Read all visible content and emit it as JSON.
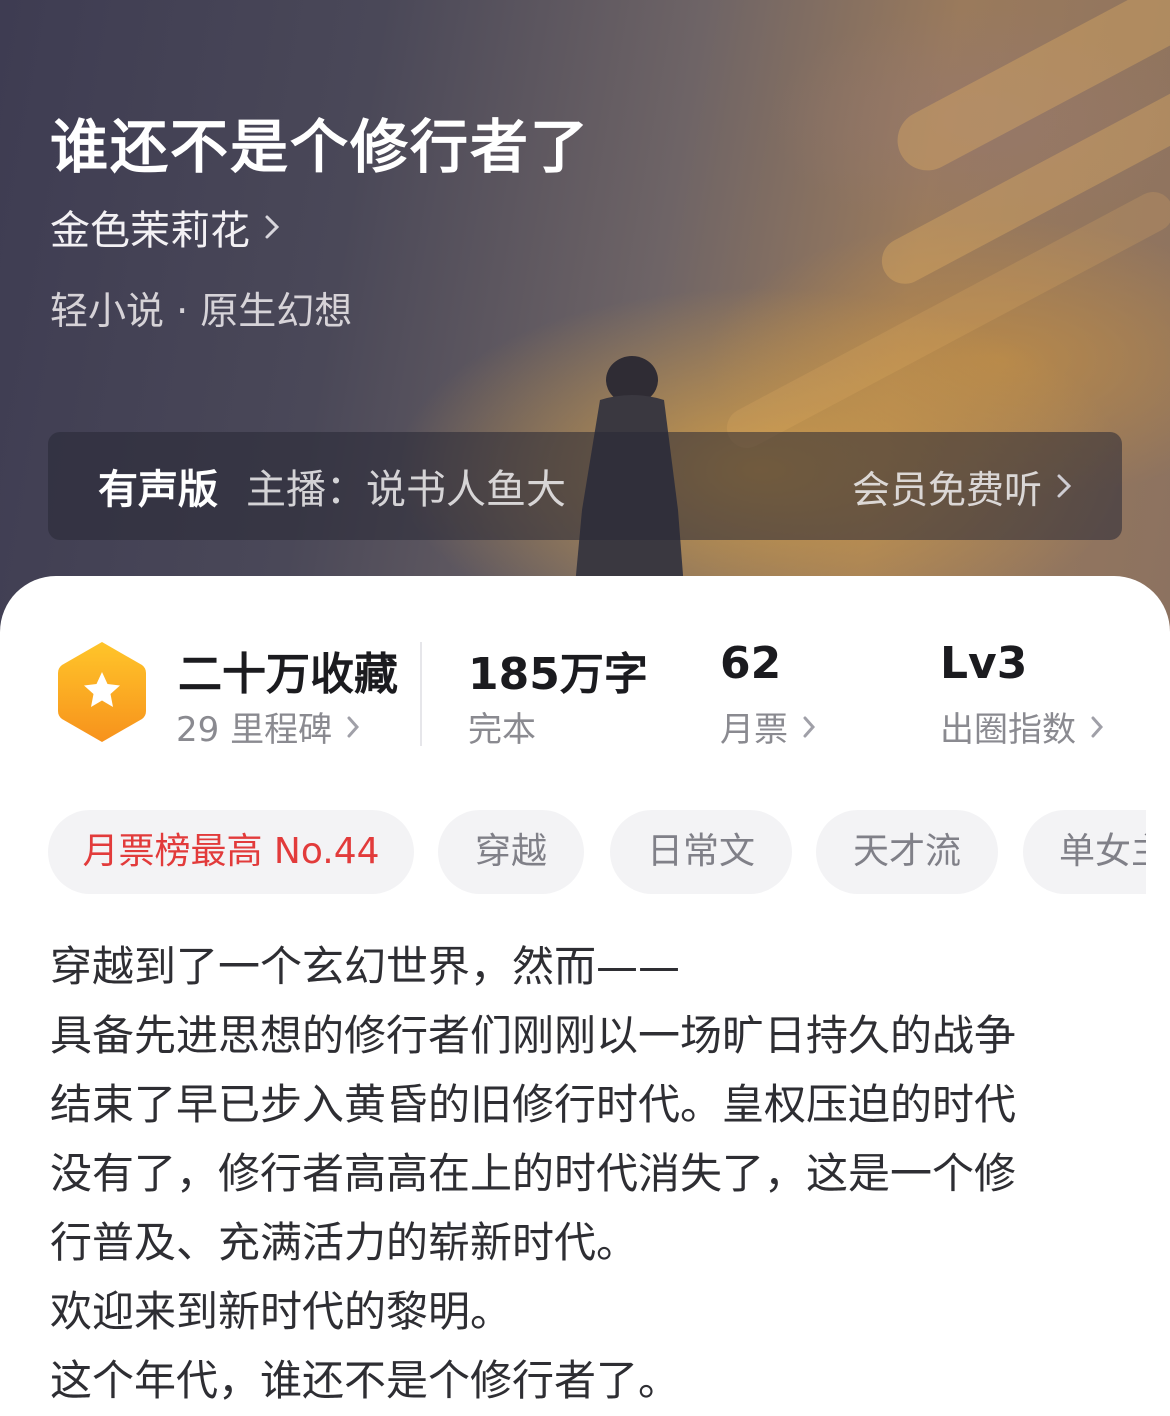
{
  "book": {
    "title": "谁还不是个修行者了",
    "author": "金色茉莉花",
    "genre": "轻小说 · 原生幻想"
  },
  "audio": {
    "label": "有声版",
    "host": "主播：说书人鱼大",
    "action": "会员免费听"
  },
  "stats": {
    "collection": {
      "main": "二十万收藏",
      "sub": "29 里程碑"
    },
    "words": {
      "main": "185万字",
      "sub": "完本"
    },
    "tickets": {
      "main": "62",
      "sub": "月票"
    },
    "level": {
      "main": "Lv3",
      "sub": "出圈指数"
    }
  },
  "tags": [
    "月票榜最高 No.44",
    "穿越",
    "日常文",
    "天才流",
    "单女主"
  ],
  "description": [
    "穿越到了一个玄幻世界，然而——",
    "具备先进思想的修行者们刚刚以一场旷日持久的战争",
    "结束了早已步入黄昏的旧修行时代。皇权压迫的时代",
    "没有了，修行者高高在上的时代消失了，这是一个修",
    "行普及、充满活力的崭新时代。",
    "欢迎来到新时代的黎明。",
    "这个年代，谁还不是个修行者了。"
  ],
  "colors": {
    "accent_red": "#e23b3b",
    "badge_orange": "#f7a51c",
    "tag_bg": "#f3f3f5"
  }
}
